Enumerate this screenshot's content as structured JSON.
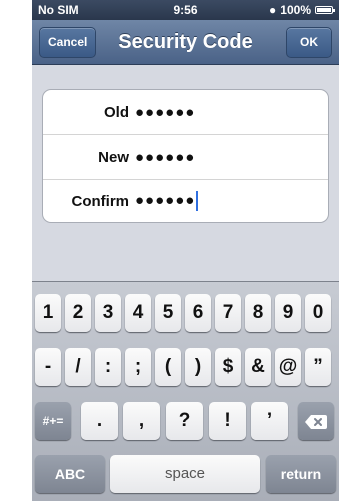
{
  "status_bar": {
    "carrier": "No SIM",
    "time": "9:56",
    "battery": "100%"
  },
  "nav": {
    "title": "Security Code",
    "cancel_label": "Cancel",
    "ok_label": "OK"
  },
  "form": {
    "rows": [
      {
        "label": "Old",
        "value": "●●●●●●"
      },
      {
        "label": "New",
        "value": "●●●●●●"
      },
      {
        "label": "Confirm",
        "value": "●●●●●●"
      }
    ]
  },
  "keyboard": {
    "row1": [
      "1",
      "2",
      "3",
      "4",
      "5",
      "6",
      "7",
      "8",
      "9",
      "0"
    ],
    "row2": [
      "-",
      "/",
      ":",
      ";",
      "(",
      ")",
      "$",
      "&",
      "@",
      "”"
    ],
    "row3": {
      "symbols_label": "#+=",
      "keys": [
        ".",
        ",",
        "?",
        "!",
        "’"
      ]
    },
    "row4": {
      "abc_label": "ABC",
      "space_label": "space",
      "return_label": "return"
    }
  }
}
